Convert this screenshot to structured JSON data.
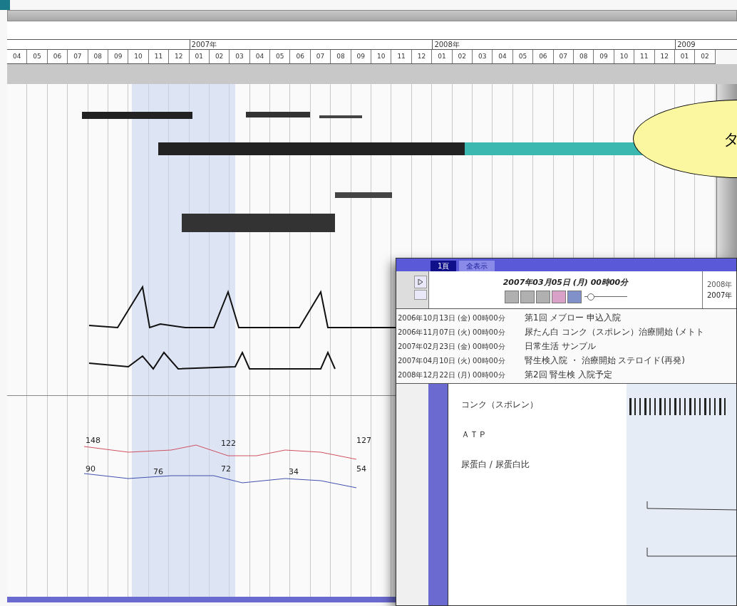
{
  "timeline": {
    "years": [
      {
        "label": "2007年"
      },
      {
        "label": "2008年"
      },
      {
        "label": "2009"
      }
    ],
    "months": [
      "04",
      "05",
      "06",
      "07",
      "08",
      "09",
      "10",
      "11",
      "12",
      "01",
      "02",
      "03",
      "04",
      "05",
      "06",
      "07",
      "08",
      "09",
      "10",
      "11",
      "12",
      "01",
      "02",
      "03",
      "04",
      "05",
      "06",
      "07",
      "08",
      "09",
      "10",
      "11",
      "12",
      "01",
      "02"
    ]
  },
  "chart_labels": {
    "upper": [
      "148",
      "122",
      "127"
    ],
    "lower": [
      "90",
      "76",
      "72",
      "34",
      "54"
    ]
  },
  "callout": {
    "text": "タ"
  },
  "popup": {
    "tabs": [
      {
        "label": "1頁",
        "selected": true
      },
      {
        "label": "全表示",
        "selected": false
      }
    ],
    "date": "2007年03月05日 (月) 00時00分",
    "zoom": {
      "level": 0.15
    },
    "year_top": "2008年",
    "year_bottom": "2007年",
    "events": [
      {
        "date": "2006年10月13日 (金) 00時00分",
        "text": "第1回 メブロー 申込入院"
      },
      {
        "date": "2006年11月07日 (火) 00時00分",
        "text": "尿たん白 コンク（スポレン）治療開始 (メトト"
      },
      {
        "date": "2007年02月23日 (金) 00時00分",
        "text": "日常生活 サンプル"
      },
      {
        "date": "2007年04月10日 (火) 00時00分",
        "text": "腎生検入院 ・ 治療開始 ステロイド(再発)"
      },
      {
        "date": "2008年12月22日 (月) 00時00分",
        "text": "第2回 腎生検 入院予定"
      }
    ],
    "rows": [
      "コンク（スポレン）",
      "ＡＴＰ",
      "尿蛋白 / 尿蛋白比"
    ]
  }
}
